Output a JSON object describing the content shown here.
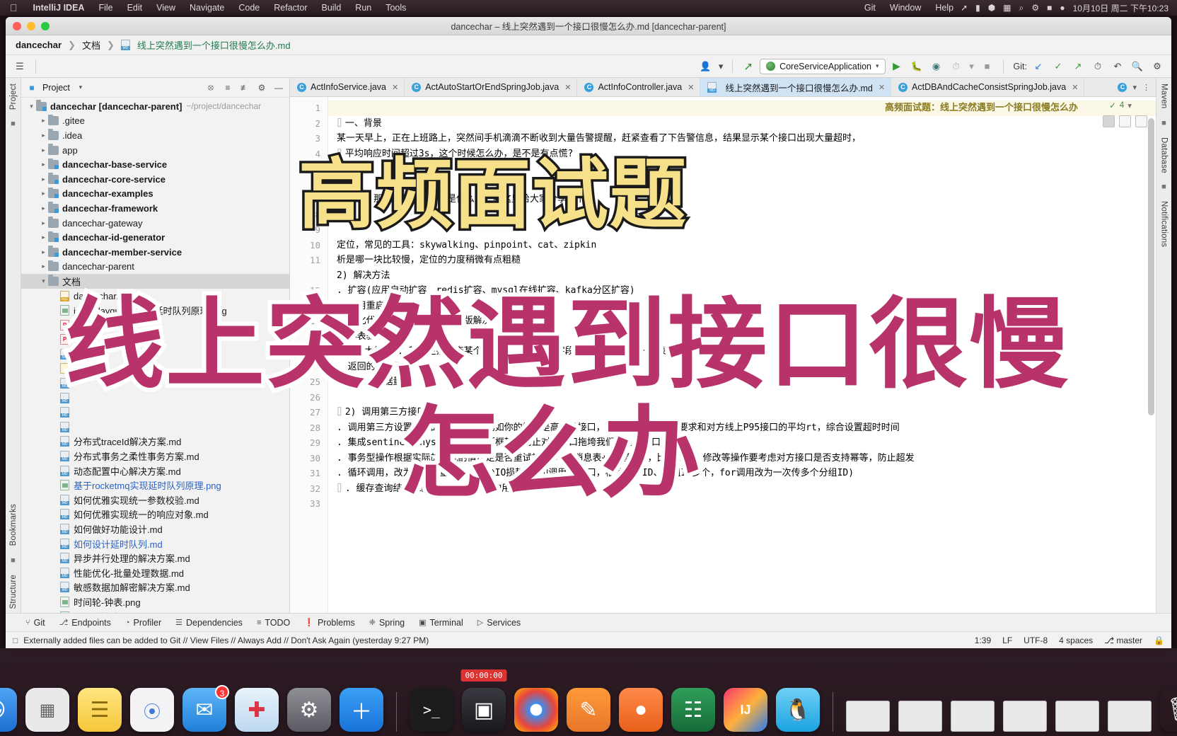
{
  "macbar": {
    "apple": "",
    "app_name": "IntelliJ IDEA",
    "menus": [
      "File",
      "Edit",
      "View",
      "Navigate",
      "Code",
      "Refactor",
      "Build",
      "Run",
      "Tools"
    ],
    "menus_right": [
      "Git",
      "Window",
      "Help"
    ],
    "clock": "10月10日 周二 下午10:23"
  },
  "window": {
    "title": "dancechar – 线上突然遇到一个接口很慢怎么办.md [dancechar-parent]"
  },
  "breadcrumb": {
    "root": "dancechar",
    "folder": "文档",
    "file": "线上突然遇到一个接口很慢怎么办.md"
  },
  "toolbar": {
    "run_config": "CoreServiceApplication",
    "git_label": "Git:",
    "search_icon": "search-icon",
    "settings_icon": "gear-icon"
  },
  "project_panel": {
    "title": "Project",
    "vertical_label": "Project",
    "tree": [
      {
        "indent": 0,
        "arrow": "v",
        "type": "module",
        "label": "dancechar [dancechar-parent]",
        "bold": true,
        "path": "~/project/dancechar"
      },
      {
        "indent": 1,
        "arrow": ">",
        "type": "folder",
        "label": ".gitee"
      },
      {
        "indent": 1,
        "arrow": ">",
        "type": "folder",
        "label": ".idea"
      },
      {
        "indent": 1,
        "arrow": ">",
        "type": "folder",
        "label": "app"
      },
      {
        "indent": 1,
        "arrow": ">",
        "type": "module",
        "label": "dancechar-base-service",
        "bold": true
      },
      {
        "indent": 1,
        "arrow": ">",
        "type": "module",
        "label": "dancechar-core-service",
        "bold": true
      },
      {
        "indent": 1,
        "arrow": ">",
        "type": "module",
        "label": "dancechar-examples",
        "bold": true
      },
      {
        "indent": 1,
        "arrow": ">",
        "type": "module",
        "label": "dancechar-framework",
        "bold": true
      },
      {
        "indent": 1,
        "arrow": ">",
        "type": "folder",
        "label": "dancechar-gateway"
      },
      {
        "indent": 1,
        "arrow": ">",
        "type": "module",
        "label": "dancechar-id-generator",
        "bold": true
      },
      {
        "indent": 1,
        "arrow": ">",
        "type": "module",
        "label": "dancechar-member-service",
        "bold": true
      },
      {
        "indent": 1,
        "arrow": ">",
        "type": "folder",
        "label": "dancechar-parent"
      },
      {
        "indent": 1,
        "arrow": "v",
        "type": "folder",
        "label": "文档",
        "selected": true
      },
      {
        "indent": 2,
        "arrow": "",
        "type": "sql",
        "label": "dancechar.sql"
      },
      {
        "indent": 2,
        "arrow": "",
        "type": "png",
        "label": "jdk delayqueue实现延时队列原理.png"
      },
      {
        "indent": 2,
        "arrow": "",
        "type": "pdf",
        "label": "k                           等.pdf"
      },
      {
        "indent": 2,
        "arrow": "",
        "type": "pdf",
        "label": "                            .pc"
      },
      {
        "indent": 2,
        "arrow": "",
        "type": "md",
        "label": "                            f"
      },
      {
        "indent": 2,
        "arrow": "",
        "type": "js",
        "label": "                            js"
      },
      {
        "indent": 2,
        "arrow": "",
        "type": "md",
        "label": ""
      },
      {
        "indent": 2,
        "arrow": "",
        "type": "md",
        "label": ""
      },
      {
        "indent": 2,
        "arrow": "",
        "type": "md",
        "label": ""
      },
      {
        "indent": 2,
        "arrow": "",
        "type": "md",
        "label": ""
      },
      {
        "indent": 2,
        "arrow": "",
        "type": "md",
        "label": "分布式traceId解决方案.md"
      },
      {
        "indent": 2,
        "arrow": "",
        "type": "md",
        "label": "分布式事务之柔性事务方案.md"
      },
      {
        "indent": 2,
        "arrow": "",
        "type": "md",
        "label": "动态配置中心解决方案.md"
      },
      {
        "indent": 2,
        "arrow": "",
        "type": "png",
        "label": "基于rocketmq实现延时队列原理.png",
        "color": "blue"
      },
      {
        "indent": 2,
        "arrow": "",
        "type": "md",
        "label": "如何优雅实现统一参数校验.md"
      },
      {
        "indent": 2,
        "arrow": "",
        "type": "md",
        "label": "如何优雅实现统一的响应对象.md"
      },
      {
        "indent": 2,
        "arrow": "",
        "type": "md",
        "label": "如何做好功能设计.md"
      },
      {
        "indent": 2,
        "arrow": "",
        "type": "md",
        "label": "如何设计延时队列.md",
        "color": "blue"
      },
      {
        "indent": 2,
        "arrow": "",
        "type": "md",
        "label": "异步并行处理的解决方案.md"
      },
      {
        "indent": 2,
        "arrow": "",
        "type": "md",
        "label": "性能优化-批量处理数据.md"
      },
      {
        "indent": 2,
        "arrow": "",
        "type": "md",
        "label": "敏感数据加解密解决方案.md"
      },
      {
        "indent": 2,
        "arrow": "",
        "type": "png",
        "label": "时间轮-钟表.png"
      },
      {
        "indent": 2,
        "arrow": "",
        "type": "png",
        "label": "时间轮算法.png"
      },
      {
        "indent": 2,
        "arrow": "",
        "type": "txt",
        "label": "环境准备.txt"
      }
    ]
  },
  "editor": {
    "tabs": [
      {
        "label": "ActInfoService.java",
        "type": "java",
        "active": false
      },
      {
        "label": "ActAutoStartOrEndSpringJob.java",
        "type": "java",
        "active": false
      },
      {
        "label": "ActInfoController.java",
        "type": "java",
        "active": false
      },
      {
        "label": "线上突然遇到一个接口很慢怎么办.md",
        "type": "md",
        "active": true
      },
      {
        "label": "ActDBAndCacheConsistSpringJob.java",
        "type": "java",
        "active": false
      }
    ],
    "inspection_count": "4",
    "lines": [
      {
        "n": "1",
        "text": "高频面试题：线上突然遇到一个接口很慢怎么办",
        "style": "h1"
      },
      {
        "n": "2",
        "text": "一、背景",
        "fold": true
      },
      {
        "n": "3",
        "text": "某一天早上，正在上班路上，突然间手机滴滴不断收到大量告警提醒，赶紧查看了下告警信息，结果显示某个接口出现大量超时，"
      },
      {
        "n": "4",
        "text": "平均响应时间超过3s，这个时候怎么办，是不是有点慌?",
        "fold": true
      },
      {
        "n": "5",
        "text": ""
      },
      {
        "n": "6",
        "text": ""
      },
      {
        "n": "7",
        "text": "大的坑。那我们的处理思路是什么呢？我这里给大家分享以下"
      },
      {
        "n": "8",
        "text": ""
      },
      {
        "n": "9",
        "text": ""
      },
      {
        "n": "10",
        "text": "定位，常见的工具：skywalking、pinpoint、cat、zipkin"
      },
      {
        "n": "11",
        "text": "析是哪一块比较慢，定位的力度稍微有点粗糙"
      },
      {
        "n": "11b",
        "text": "2) 解决方法"
      },
      {
        "n": "12",
        "text": ". 扩容(应用自动扩容、redis扩容、mysql在线扩容、kafka分区扩容)"
      },
      {
        "n": "13",
        "text": ". 应用重启大法"
      },
      {
        "n": "14",
        "text": ". 优化代码逻辑，走hotfix发版解决"
      },
      {
        "n": "22",
        "text": ". 小表驱动大表("
      },
      {
        "n": "23",
        "text": ". SQL太复杂(;                                         某个主接口查某个表数据，然后关联字段作为条件从另外一个表查询，进行内存拼接)"
      },
      {
        "n": "24",
        "text": ". 返回的数据量太"
      },
      {
        "n": "25",
        "text": ". 单表数据量太",
        "fold": true
      },
      {
        "n": "26",
        "text": ""
      },
      {
        "n": "27",
        "text": "2) 调用第三方接口",
        "fold": true
      },
      {
        "n": "28",
        "text": ". 调用第三方设置合理的超时时间，比如你的接口是高并发接口，从自身对方接口的要求和对方线上P95接口的平均rt，综合设置超时时间"
      },
      {
        "n": "29",
        "text": ". 集成sentinel或hystrix限流熔断框架，防止对方接口拖垮我们自己的接口"
      },
      {
        "n": "30",
        "text": ". 事务型操作根据实际的情况酌情决定是否重试补偿(本地消息表+job重试)，比如新增、修改等操作要考虑对方接口是否支持幂等，防止超发"
      },
      {
        "n": "31",
        "text": ". 循环调用，改为单次批量调用，减少IO损耗(比如调用AB接口，根据用户ID、分组ID多个，for调用改为一次传多个分组ID)"
      },
      {
        "n": "32",
        "text": ". 缓存查询结果(比如根据用户ID查询用户信息)",
        "fold": true
      },
      {
        "n": "33",
        "text": ""
      }
    ]
  },
  "tool_window_bar": {
    "items": [
      "Git",
      "Endpoints",
      "Profiler",
      "Dependencies",
      "TODO",
      "Problems",
      "Spring",
      "Terminal",
      "Services"
    ]
  },
  "status_bar": {
    "message": "Externally added files can be added to Git // View Files // Always Add // Don't Ask Again (yesterday 9:27 PM)",
    "caret": "1:39",
    "line_sep": "LF",
    "encoding": "UTF-8",
    "indent": "4 spaces",
    "branch": "master"
  },
  "side_strips": {
    "left_bottom": [
      "Bookmarks",
      "Structure"
    ],
    "right": [
      "Maven",
      "Database",
      "Notifications"
    ]
  },
  "overlays": {
    "yellow_caption": "高频面试题",
    "pink_line1": "线上突然遇到接口很慢",
    "pink_line2": "怎么办"
  },
  "dock": {
    "recording_timer": "00:00:00",
    "mail_badge": "3"
  },
  "colors": {
    "accent_pink": "#b8336a",
    "accent_yellow": "#f7e08a",
    "tab_active": "#cfe3f5",
    "heading": "#8a7b20"
  }
}
